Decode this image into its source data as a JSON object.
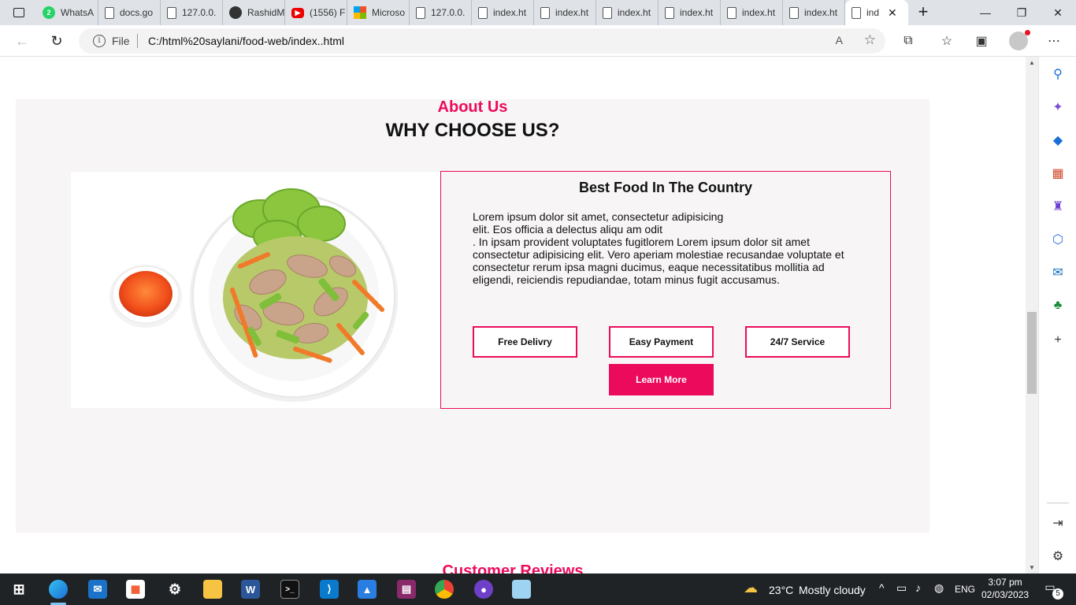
{
  "browser": {
    "tabs": [
      {
        "label": "WhatsA",
        "icon": "whatsapp-icon",
        "badge": "2"
      },
      {
        "label": "docs.go",
        "icon": "doc-icon"
      },
      {
        "label": "127.0.0.",
        "icon": "page-icon"
      },
      {
        "label": "RashidM",
        "icon": "github-icon"
      },
      {
        "label": "(1556) F",
        "icon": "youtube-icon"
      },
      {
        "label": "Microso",
        "icon": "microsoft-icon"
      },
      {
        "label": "127.0.0.",
        "icon": "page-icon"
      },
      {
        "label": "index.ht",
        "icon": "page-icon"
      },
      {
        "label": "index.ht",
        "icon": "page-icon"
      },
      {
        "label": "index.ht",
        "icon": "page-icon"
      },
      {
        "label": "index.ht",
        "icon": "page-icon"
      },
      {
        "label": "index.ht",
        "icon": "page-icon"
      },
      {
        "label": "index.ht",
        "icon": "page-icon"
      }
    ],
    "active_tab": {
      "label": "ind",
      "close": "✕"
    },
    "new_tab": "+",
    "address": {
      "scheme_label": "File",
      "url": "C:/html%20saylani/food-web/index..html"
    },
    "read_aloud": "A",
    "window_controls": {
      "minimize": "—",
      "maximize": "❐",
      "close": "✕"
    }
  },
  "page": {
    "about": {
      "subtitle": "About Us",
      "title": "WHY CHOOSE US?",
      "card_title": "Best Food In The Country",
      "paragraph": "Lorem ipsum dolor sit amet, consectetur adipisicing\nelit. Eos officia a delectus aliqu am odit\n. In ipsam provident voluptates fugitlorem Lorem ipsum dolor sit amet\nconsectetur adipisicing elit. Vero aperiam molestiae recusandae voluptate et\nconsectetur rerum ipsa magni ducimus, eaque necessitatibus mollitia ad\neligendi, reiciendis repudiandae, totam minus fugit accusamus.",
      "buttons": [
        "Free Delivry",
        "Easy Payment",
        "24/7 Service"
      ],
      "cta": "Learn More",
      "accent_color": "#ec0a5c"
    },
    "next_section_title": "Customer Reviews"
  },
  "taskbar": {
    "weather": {
      "temp": "23°C",
      "condition": "Mostly cloudy"
    },
    "language": "ENG",
    "time": "3:07 pm",
    "date": "02/03/2023",
    "notification_count": "5"
  }
}
